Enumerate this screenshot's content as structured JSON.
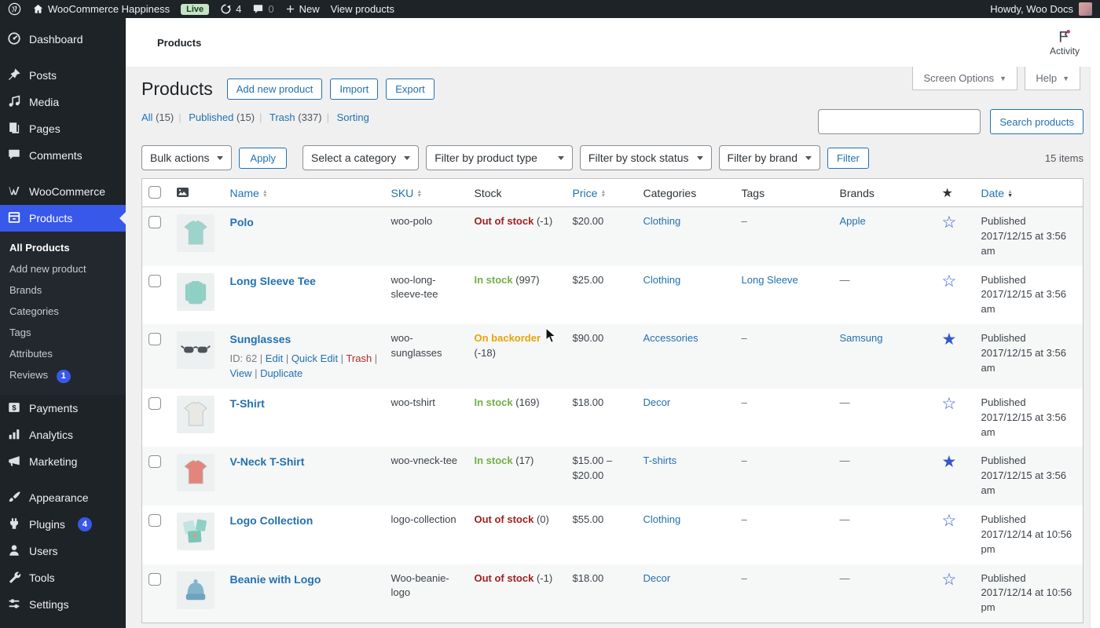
{
  "admin_bar": {
    "site_name": "WooCommerce Happiness",
    "live_badge": "Live",
    "updates_count": "4",
    "comments_count": "0",
    "new_label": "New",
    "view_products_label": "View products",
    "howdy": "Howdy, Woo Docs"
  },
  "sidebar": {
    "items": [
      {
        "label": "Dashboard",
        "icon": "dashboard-icon"
      },
      {
        "label": "Posts",
        "icon": "pin-icon",
        "gap_before": true
      },
      {
        "label": "Media",
        "icon": "media-icon"
      },
      {
        "label": "Pages",
        "icon": "pages-icon"
      },
      {
        "label": "Comments",
        "icon": "comments-icon"
      },
      {
        "label": "WooCommerce",
        "icon": "woocommerce-icon",
        "gap_before": true
      },
      {
        "label": "Products",
        "icon": "products-icon",
        "active": true,
        "has_submenu": true
      },
      {
        "label": "Payments",
        "icon": "payments-icon"
      },
      {
        "label": "Analytics",
        "icon": "analytics-icon"
      },
      {
        "label": "Marketing",
        "icon": "marketing-icon"
      },
      {
        "label": "Appearance",
        "icon": "appearance-icon",
        "gap_before": true
      },
      {
        "label": "Plugins",
        "icon": "plugins-icon",
        "badge": "4"
      },
      {
        "label": "Users",
        "icon": "users-icon"
      },
      {
        "label": "Tools",
        "icon": "tools-icon"
      },
      {
        "label": "Settings",
        "icon": "settings-icon"
      }
    ],
    "submenu": [
      {
        "label": "All Products",
        "active": true
      },
      {
        "label": "Add new product"
      },
      {
        "label": "Brands"
      },
      {
        "label": "Categories"
      },
      {
        "label": "Tags"
      },
      {
        "label": "Attributes"
      },
      {
        "label": "Reviews",
        "badge": "1"
      }
    ]
  },
  "header": {
    "breadcrumb": "Products",
    "activity_label": "Activity",
    "screen_options_label": "Screen Options",
    "help_label": "Help"
  },
  "page": {
    "title": "Products",
    "buttons": {
      "add": "Add new product",
      "import": "Import",
      "export": "Export"
    },
    "views": [
      {
        "label": "All",
        "count": "(15)"
      },
      {
        "label": "Published",
        "count": "(15)"
      },
      {
        "label": "Trash",
        "count": "(337)"
      },
      {
        "label": "Sorting",
        "count": ""
      }
    ],
    "search_button": "Search products",
    "filters": {
      "bulk_actions": "Bulk actions",
      "apply": "Apply",
      "category": "Select a category",
      "product_type": "Filter by product type",
      "stock_status": "Filter by stock status",
      "brand": "Filter by brand",
      "filter": "Filter"
    },
    "items_count": "15 items"
  },
  "table": {
    "headers": {
      "name": "Name",
      "sku": "SKU",
      "stock": "Stock",
      "price": "Price",
      "categories": "Categories",
      "tags": "Tags",
      "brands": "Brands",
      "date": "Date"
    },
    "rows": [
      {
        "name": "Polo",
        "sku": "woo-polo",
        "stock": {
          "status": "Out of stock",
          "state": "out",
          "count": "(-1)"
        },
        "price": "$20.00",
        "category": "Clothing",
        "tag": {
          "text": "–",
          "link": false
        },
        "brand": {
          "text": "Apple",
          "link": true
        },
        "featured": false,
        "date": "Published 2017/12/15 at 3:56 am",
        "thumb": {
          "shape": "tshirt",
          "color": "#9bd4cd"
        }
      },
      {
        "name": "Long Sleeve Tee",
        "sku": "woo-long-sleeve-tee",
        "stock": {
          "status": "In stock",
          "state": "in",
          "count": "(997)"
        },
        "price": "$25.00",
        "category": "Clothing",
        "tag": {
          "text": "Long Sleeve",
          "link": true
        },
        "brand": {
          "text": "—",
          "link": false
        },
        "featured": false,
        "date": "Published 2017/12/15 at 3:56 am",
        "thumb": {
          "shape": "longsleeve",
          "color": "#8fd0c5"
        }
      },
      {
        "name": "Sunglasses",
        "sku": "woo-sunglasses",
        "stock": {
          "status": "On backorder",
          "state": "back",
          "count": "(-18)"
        },
        "price": "$90.00",
        "category": "Accessories",
        "tag": {
          "text": "–",
          "link": false
        },
        "brand": {
          "text": "Samsung",
          "link": true
        },
        "featured": true,
        "date": "Published 2017/12/15 at 3:56 am",
        "thumb": {
          "shape": "sunglasses",
          "color": "#4d5358"
        },
        "actions": [
          {
            "text": "ID: 62",
            "style": "gray"
          },
          {
            "text": "Edit",
            "style": "link"
          },
          {
            "text": "Quick Edit",
            "style": "link"
          },
          {
            "text": "Trash",
            "style": "red"
          },
          {
            "text": "View",
            "style": "link"
          },
          {
            "text": "Duplicate",
            "style": "link"
          }
        ]
      },
      {
        "name": "T-Shirt",
        "sku": "woo-tshirt",
        "stock": {
          "status": "In stock",
          "state": "in",
          "count": "(169)"
        },
        "price": "$18.00",
        "category": "Decor",
        "tag": {
          "text": "–",
          "link": false
        },
        "brand": {
          "text": "—",
          "link": false
        },
        "featured": false,
        "date": "Published 2017/12/15 at 3:56 am",
        "thumb": {
          "shape": "tshirt",
          "color": "#e8e8e4"
        }
      },
      {
        "name": "V-Neck T-Shirt",
        "sku": "woo-vneck-tee",
        "stock": {
          "status": "In stock",
          "state": "in",
          "count": "(17)"
        },
        "price": "$15.00 – $20.00",
        "category": "T-shirts",
        "tag": {
          "text": "–",
          "link": false
        },
        "brand": {
          "text": "—",
          "link": false
        },
        "featured": true,
        "date": "Published 2017/12/15 at 3:56 am",
        "thumb": {
          "shape": "tshirt",
          "color": "#e2857c"
        }
      },
      {
        "name": "Logo Collection",
        "sku": "logo-collection",
        "stock": {
          "status": "Out of stock",
          "state": "out",
          "count": "(0)"
        },
        "price": "$55.00",
        "category": "Clothing",
        "tag": {
          "text": "–",
          "link": false
        },
        "brand": {
          "text": "—",
          "link": false
        },
        "featured": false,
        "date": "Published 2017/12/14 at 10:56 pm",
        "thumb": {
          "shape": "collection",
          "color": "#9bd4cd"
        }
      },
      {
        "name": "Beanie with Logo",
        "sku": "Woo-beanie-logo",
        "stock": {
          "status": "Out of stock",
          "state": "out",
          "count": "(-1)"
        },
        "price": "$18.00",
        "category": "Decor",
        "tag": {
          "text": "–",
          "link": false
        },
        "brand": {
          "text": "—",
          "link": false
        },
        "featured": false,
        "date": "Published 2017/12/14 at 10:56 pm",
        "thumb": {
          "shape": "beanie",
          "color": "#83b4cc"
        }
      }
    ]
  },
  "colors": {
    "accent_link_blue": "#2271b1",
    "active_menu_blue": "#3858e9",
    "star_blue": "#3056d6",
    "in_stock_green": "#72ae47",
    "backorder_amber": "#e8a404",
    "out_of_stock_red": "#9f2121",
    "trash_red": "#b32d2e",
    "live_badge_bg": "#c6e3c6",
    "sidebar_bg": "#1d2327"
  }
}
